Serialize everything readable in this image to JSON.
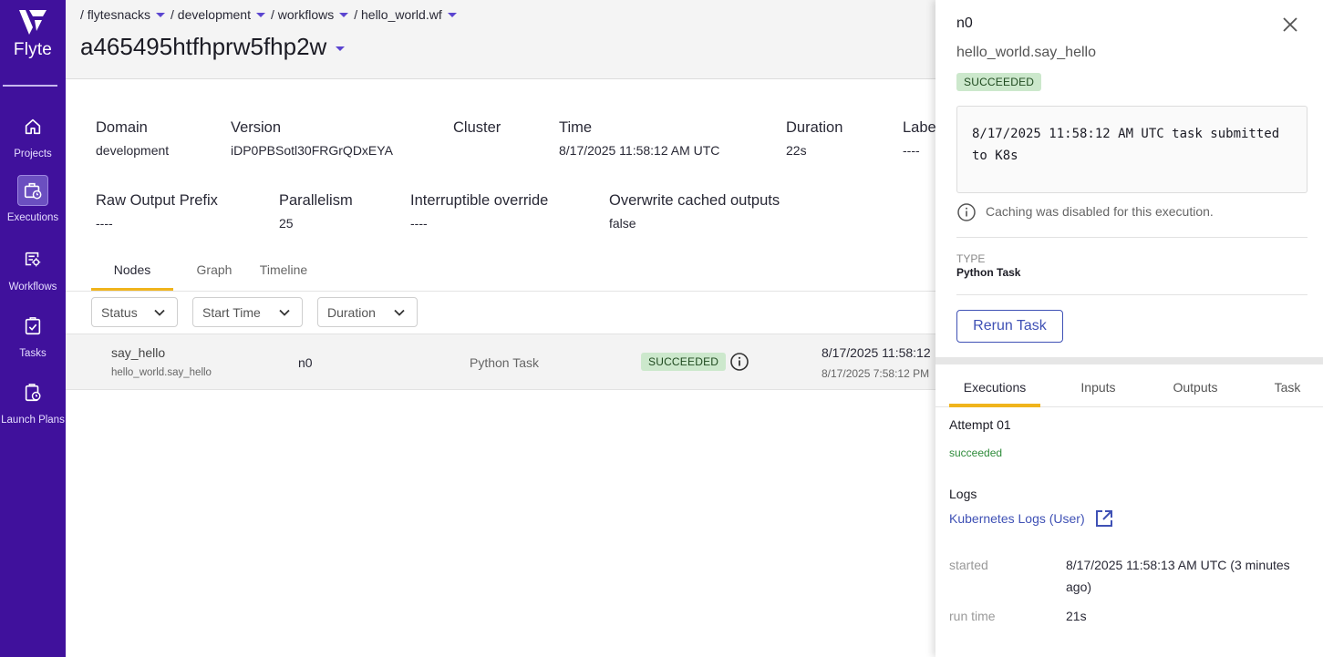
{
  "sidebar": {
    "logo_text": "Flyte",
    "items": [
      {
        "label": "Projects",
        "icon": "home-icon"
      },
      {
        "label": "Executions",
        "icon": "executions-icon"
      },
      {
        "label": "Workflows",
        "icon": "workflows-icon"
      },
      {
        "label": "Tasks",
        "icon": "tasks-icon"
      },
      {
        "label": "Launch Plans",
        "icon": "launch-plans-icon"
      }
    ]
  },
  "breadcrumb": [
    "/ flytesnacks",
    "/ development",
    "/ workflows",
    "/ hello_world.wf"
  ],
  "execution_id": "a465495htfhprw5fhp2w",
  "meta": {
    "domain": {
      "label": "Domain",
      "value": "development"
    },
    "version": {
      "label": "Version",
      "value": "iDP0PBSotl30FRGrQDxEYA"
    },
    "cluster": {
      "label": "Cluster",
      "value": ""
    },
    "time": {
      "label": "Time",
      "value": "8/17/2025 11:58:12 AM UTC"
    },
    "duration": {
      "label": "Duration",
      "value": "22s"
    },
    "labels": {
      "label": "Labe",
      "value": "----"
    },
    "raw_output": {
      "label": "Raw Output Prefix",
      "value": "----"
    },
    "parallelism": {
      "label": "Parallelism",
      "value": "25"
    },
    "interruptible": {
      "label": "Interruptible override",
      "value": "----"
    },
    "overwrite": {
      "label": "Overwrite cached outputs",
      "value": "false"
    }
  },
  "tabs": [
    "Nodes",
    "Graph",
    "Timeline"
  ],
  "filters": [
    "Status",
    "Start Time",
    "Duration"
  ],
  "node_row": {
    "name": "say_hello",
    "subname": "hello_world.say_hello",
    "node_id": "n0",
    "type": "Python Task",
    "status": "SUCCEEDED",
    "start_utc": "8/17/2025 11:58:12",
    "start_local": "8/17/2025 7:58:12 PM"
  },
  "panel": {
    "node_id": "n0",
    "task_name": "hello_world.say_hello",
    "status": "SUCCEEDED",
    "log_message": "8/17/2025 11:58:12 AM UTC task submitted to K8s",
    "cache_note": "Caching was disabled for this execution.",
    "type_label": "TYPE",
    "type_value": "Python Task",
    "rerun_label": "Rerun Task",
    "tabs": [
      "Executions",
      "Inputs",
      "Outputs",
      "Task"
    ],
    "attempt": "Attempt 01",
    "attempt_status": "succeeded",
    "logs_heading": "Logs",
    "log_link": "Kubernetes Logs (User)",
    "started_label": "started",
    "started_value": "8/17/2025 11:58:13 AM UTC (3 minutes",
    "started_value_2": "ago)",
    "runtime_label": "run time",
    "runtime_value": "21s"
  },
  "colors": {
    "sidebar_bg": "#40119c",
    "accent_tab": "#f0b41c",
    "success_bg": "#cce8cc",
    "link": "#3f51b5",
    "caret": "#5b45d0"
  }
}
